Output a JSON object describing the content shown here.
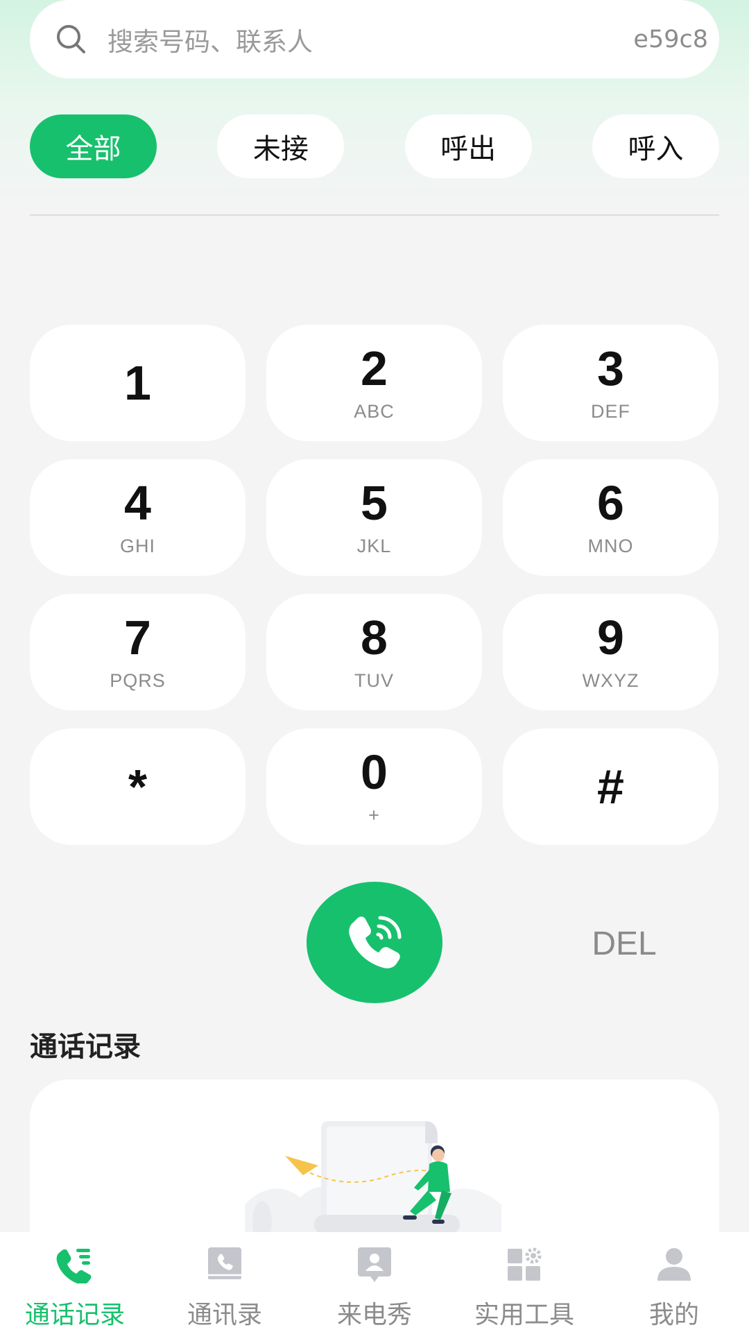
{
  "search": {
    "placeholder": "搜索号码、联系人",
    "code": "e59c8"
  },
  "filters": [
    {
      "label": "全部",
      "active": true
    },
    {
      "label": "未接",
      "active": false
    },
    {
      "label": "呼出",
      "active": false
    },
    {
      "label": "呼入",
      "active": false
    }
  ],
  "keypad": [
    {
      "digit": "1",
      "letters": ""
    },
    {
      "digit": "2",
      "letters": "ABC"
    },
    {
      "digit": "3",
      "letters": "DEF"
    },
    {
      "digit": "4",
      "letters": "GHI"
    },
    {
      "digit": "5",
      "letters": "JKL"
    },
    {
      "digit": "6",
      "letters": "MNO"
    },
    {
      "digit": "7",
      "letters": "PQRS"
    },
    {
      "digit": "8",
      "letters": "TUV"
    },
    {
      "digit": "9",
      "letters": "WXYZ"
    },
    {
      "digit": "*",
      "letters": ""
    },
    {
      "digit": "0",
      "letters": "+"
    },
    {
      "digit": "#",
      "letters": ""
    }
  ],
  "actions": {
    "del_label": "DEL"
  },
  "section": {
    "title": "通话记录"
  },
  "tabbar": [
    {
      "label": "通话记录",
      "icon": "call-log-icon",
      "active": true
    },
    {
      "label": "通讯录",
      "icon": "contacts-book-icon",
      "active": false
    },
    {
      "label": "来电秀",
      "icon": "caller-show-icon",
      "active": false
    },
    {
      "label": "实用工具",
      "icon": "tools-icon",
      "active": false
    },
    {
      "label": "我的",
      "icon": "profile-icon",
      "active": false
    }
  ],
  "colors": {
    "accent": "#17c06d",
    "inactive": "#8b8b8b",
    "background": "#f4f4f5"
  }
}
